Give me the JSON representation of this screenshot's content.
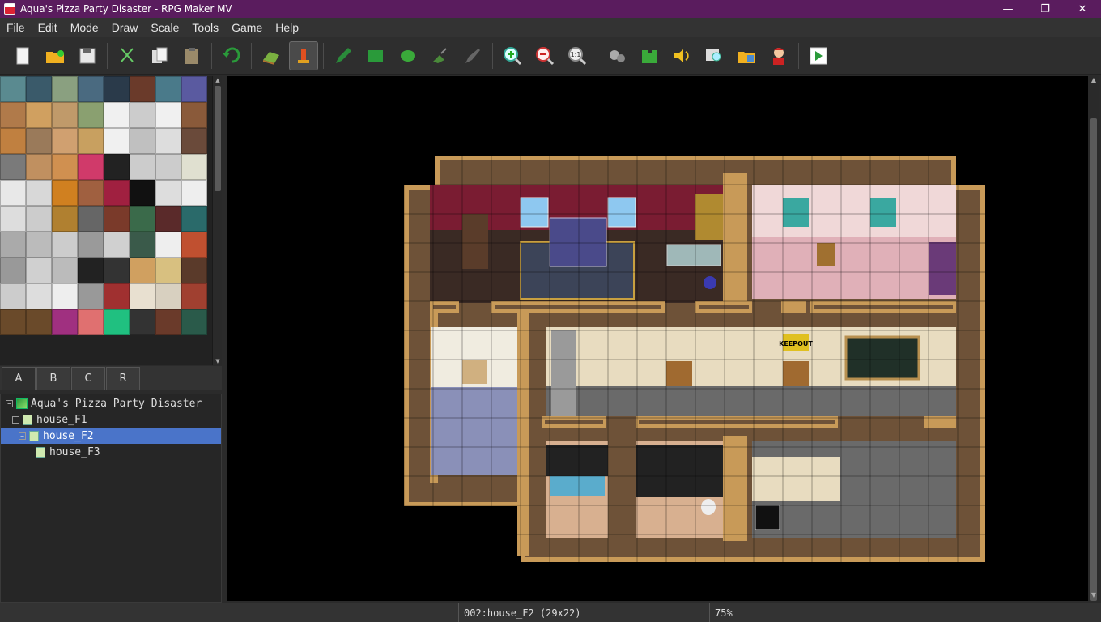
{
  "window": {
    "title": "Aqua's Pizza Party Disaster - RPG Maker MV",
    "minimize": "—",
    "maximize": "❐",
    "close": "✕"
  },
  "menu": [
    "File",
    "Edit",
    "Mode",
    "Draw",
    "Scale",
    "Tools",
    "Game",
    "Help"
  ],
  "toolbar": {
    "groups": [
      [
        "new-project",
        "open-project",
        "save-project"
      ],
      [
        "cut",
        "copy",
        "paste"
      ],
      [
        "undo"
      ],
      [
        "map-mode",
        "event-mode"
      ],
      [
        "pencil",
        "rectangle",
        "ellipse",
        "flood-fill",
        "shadow-pen"
      ],
      [
        "zoom-in",
        "zoom-out",
        "actual-size"
      ],
      [
        "database",
        "plugin-manager",
        "sound-test",
        "event-searcher",
        "resource-manager",
        "character-generator"
      ],
      [
        "playtest"
      ]
    ],
    "active": "event-mode"
  },
  "tileset_tabs": [
    "A",
    "B",
    "C",
    "R"
  ],
  "tileset_active_tab": "A",
  "map_tree": [
    {
      "label": "Aqua's Pizza Party Disaster",
      "type": "project",
      "depth": 0,
      "expander": "−"
    },
    {
      "label": "house_F1",
      "type": "map",
      "depth": 1,
      "expander": "−"
    },
    {
      "label": "house_F2",
      "type": "map",
      "depth": 1,
      "expander": "−",
      "selected": true
    },
    {
      "label": "house_F3",
      "type": "map",
      "depth": 2
    }
  ],
  "map_signs": {
    "keep_out": "KEEPOUT"
  },
  "status": {
    "map_info": "002:house_F2 (29x22)",
    "zoom": "75%"
  },
  "colors": {
    "title_bar": "#5a1c5e",
    "selection": "#4a74c9",
    "wall_trim": "#c89a58"
  }
}
